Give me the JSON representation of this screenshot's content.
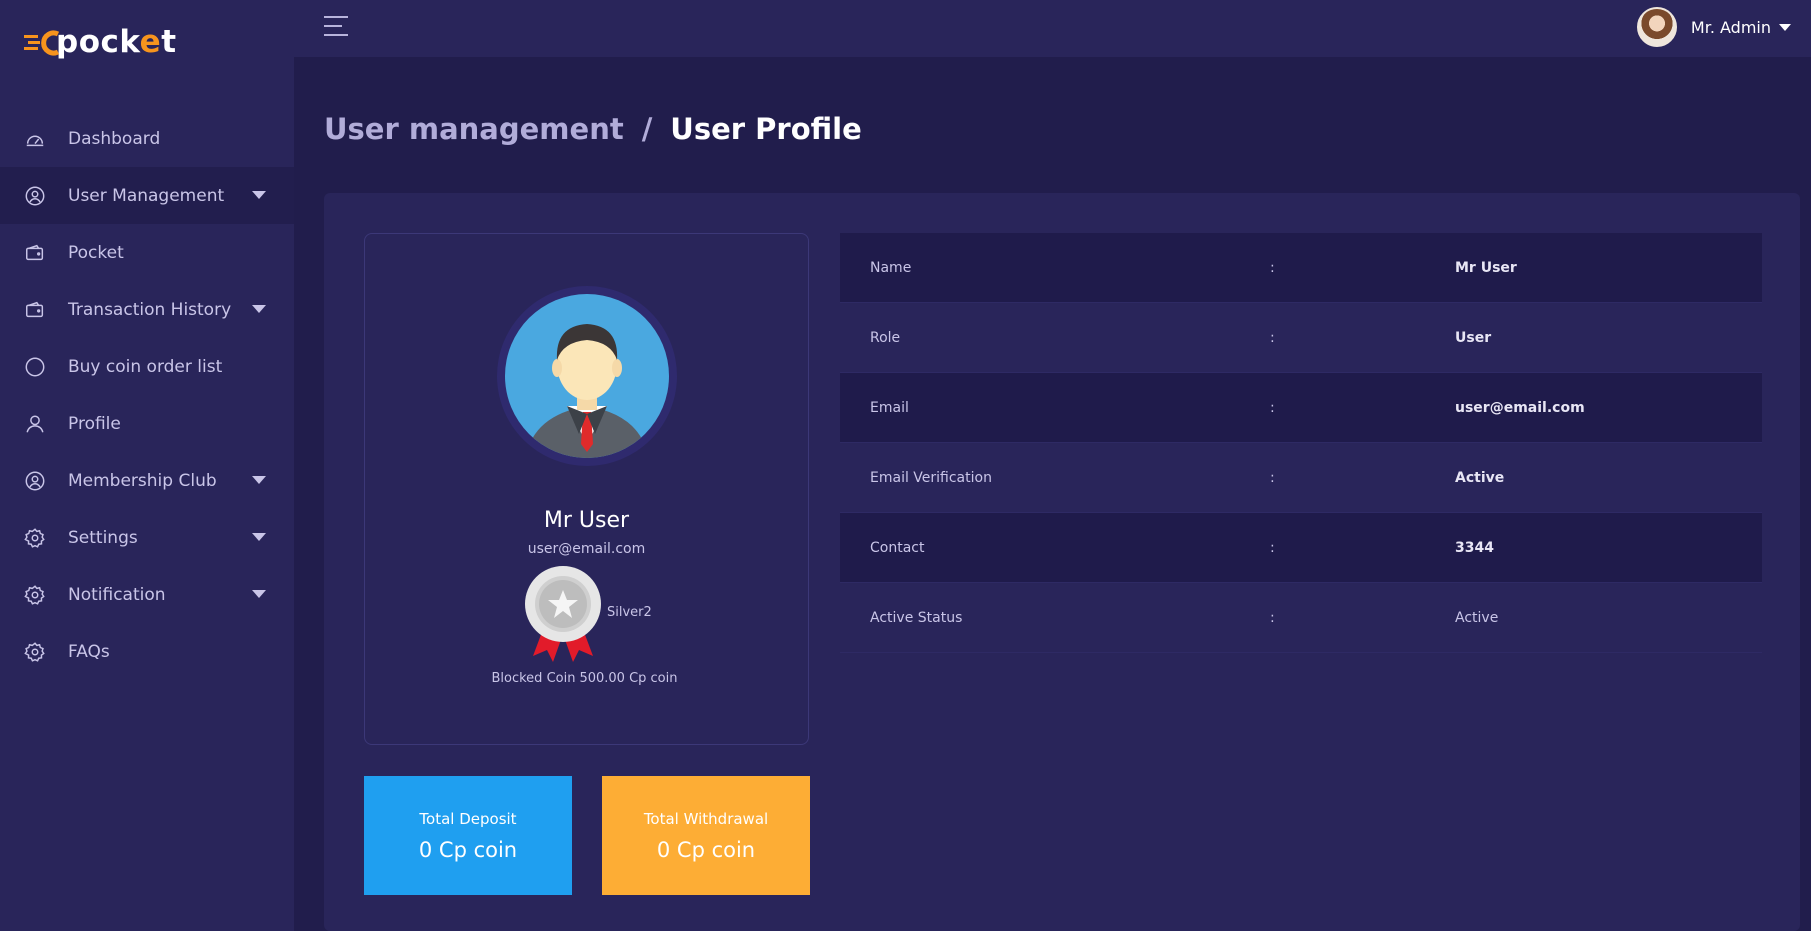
{
  "brand": {
    "logo_prefix": "c",
    "logo_text_a": "pock",
    "logo_accent": "e",
    "logo_text_b": "t"
  },
  "sidebar": {
    "items": [
      {
        "label": "Dashboard",
        "icon": "speedometer-icon",
        "has_caret": false,
        "active": false
      },
      {
        "label": "User Management",
        "icon": "user-circle-icon",
        "has_caret": true,
        "active": true
      },
      {
        "label": "Pocket",
        "icon": "wallet-icon",
        "has_caret": false,
        "active": false
      },
      {
        "label": "Transaction History",
        "icon": "wallet-icon",
        "has_caret": true,
        "active": false
      },
      {
        "label": "Buy coin order list",
        "icon": "circle-icon",
        "has_caret": false,
        "active": false
      },
      {
        "label": "Profile",
        "icon": "user-icon",
        "has_caret": false,
        "active": false
      },
      {
        "label": "Membership Club",
        "icon": "user-circle-icon",
        "has_caret": true,
        "active": false
      },
      {
        "label": "Settings",
        "icon": "gear-icon",
        "has_caret": true,
        "active": false
      },
      {
        "label": "Notification",
        "icon": "gear-icon",
        "has_caret": true,
        "active": false
      },
      {
        "label": "FAQs",
        "icon": "gear-icon",
        "has_caret": false,
        "active": false
      }
    ]
  },
  "topbar": {
    "user_name": "Mr. Admin"
  },
  "breadcrumb": {
    "parent": "User management",
    "separator": "/",
    "current": "User Profile"
  },
  "profile": {
    "name": "Mr User",
    "email": "user@email.com",
    "badge": "Silver2",
    "blocked_label": "Blocked Coin",
    "blocked_value": "500.00 Cp coin"
  },
  "stats": {
    "deposit": {
      "label": "Total Deposit",
      "value": "0 Cp coin",
      "color": "#1f9ff0"
    },
    "withdrawal": {
      "label": "Total Withdrawal",
      "value": "0 Cp coin",
      "color": "#fdad35"
    }
  },
  "details": [
    {
      "label": "Name",
      "colon": ":",
      "value": "Mr User"
    },
    {
      "label": "Role",
      "colon": ":",
      "value": "User"
    },
    {
      "label": "Email",
      "colon": ":",
      "value": "user@email.com"
    },
    {
      "label": "Email Verification",
      "colon": ":",
      "value": "Active"
    },
    {
      "label": "Contact",
      "colon": ":",
      "value": "3344"
    },
    {
      "label": "Active Status",
      "colon": ":",
      "value": "Active"
    }
  ]
}
